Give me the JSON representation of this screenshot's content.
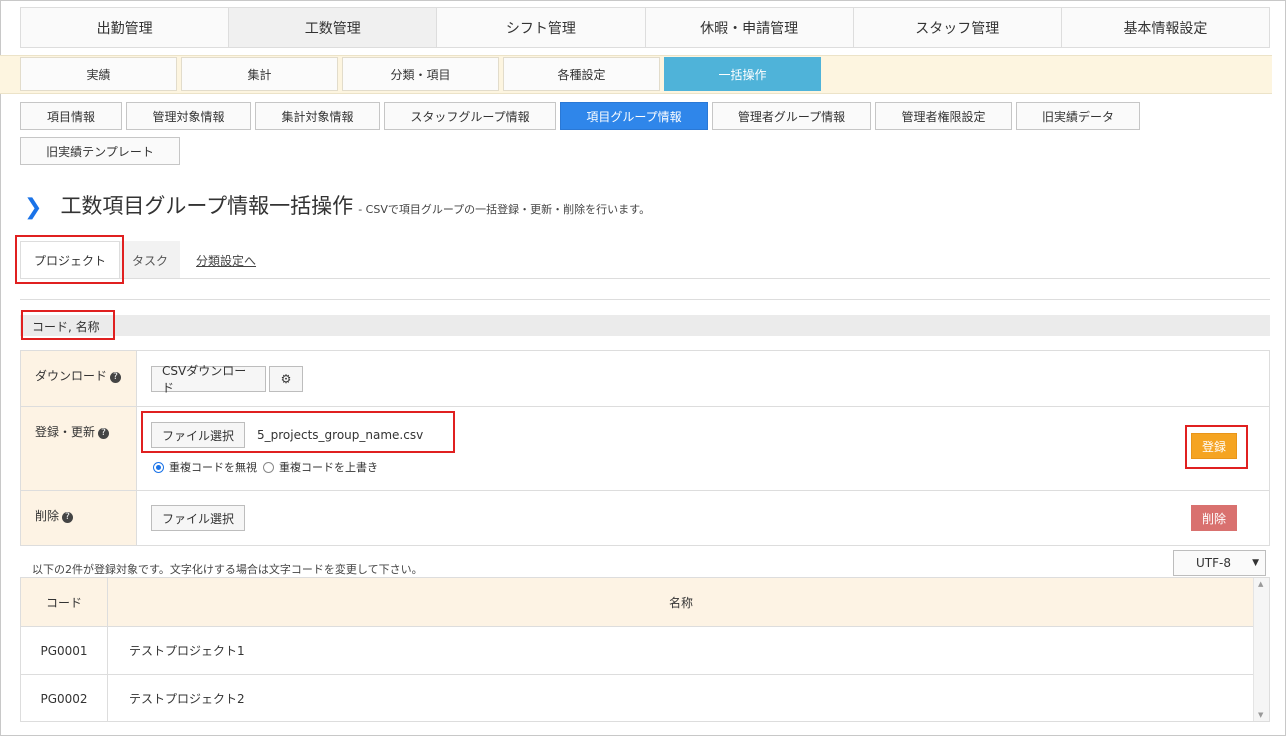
{
  "main_nav": [
    "出勤管理",
    "工数管理",
    "シフト管理",
    "休暇・申請管理",
    "スタッフ管理",
    "基本情報設定"
  ],
  "sub_nav": [
    "実績",
    "集計",
    "分類・項目",
    "各種設定",
    "一括操作"
  ],
  "buttons_row1": [
    "項目情報",
    "管理対象情報",
    "集計対象情報",
    "スタッフグループ情報",
    "項目グループ情報",
    "管理者グループ情報",
    "管理者権限設定",
    "旧実績データ"
  ],
  "buttons_row2": [
    "旧実績テンプレート"
  ],
  "heading": {
    "title": "工数項目グループ情報一括操作",
    "desc": "- CSVで項目グループの一括登録・更新・削除を行います。"
  },
  "tabs": {
    "project": "プロジェクト",
    "task": "タスク",
    "link": "分類設定へ"
  },
  "code_label": "コード, 名称",
  "form": {
    "download_label": "ダウンロード",
    "csv_download": "CSVダウンロード",
    "register_label": "登録・更新",
    "file_select": "ファイル選択",
    "file_name": "5_projects_group_name.csv",
    "radio_ignore": "重複コードを無視",
    "radio_overwrite": "重複コードを上書き",
    "register_btn": "登録",
    "delete_label": "削除",
    "delete_btn": "削除"
  },
  "notice": "以下の2件が登録対象です。文字化けする場合は文字コードを変更して下さい。",
  "encoding": "UTF-8",
  "table": {
    "headers": [
      "コード",
      "名称"
    ],
    "rows": [
      [
        "PG0001",
        "テストプロジェクト1"
      ],
      [
        "PG0002",
        "テストプロジェクト2"
      ]
    ]
  },
  "colors": {
    "accent_blue": "#2f86ea",
    "sub_active": "#4fb3d9",
    "register_orange": "#f5a422",
    "delete_red": "#d9716f",
    "highlight_red": "#e02020"
  }
}
